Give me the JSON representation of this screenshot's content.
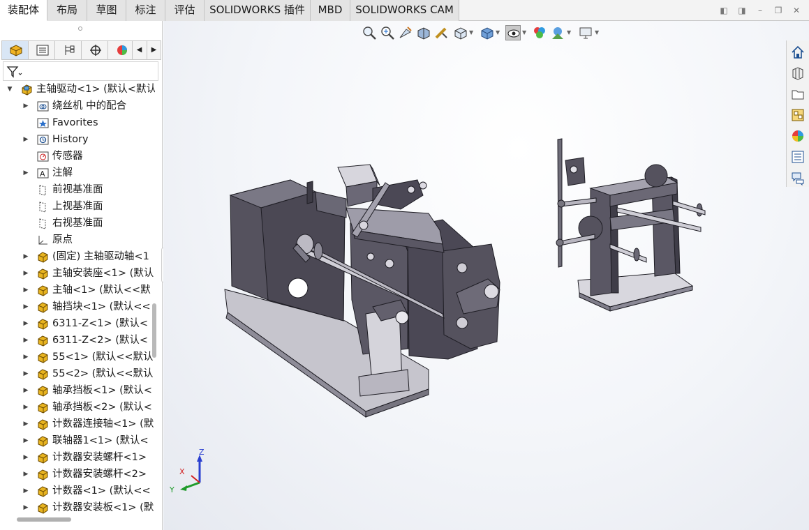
{
  "tabs": [
    "装配体",
    "布局",
    "草图",
    "标注",
    "评估",
    "SOLIDWORKS 插件",
    "MBD",
    "SOLIDWORKS CAM"
  ],
  "active_tab": "装配体",
  "tree": {
    "root": "主轴驱动<1> (默认<默认",
    "items": [
      {
        "label": "绕丝机 中的配合",
        "icon": "mates-folder-icon"
      },
      {
        "label": "Favorites",
        "icon": "favorites-folder-icon"
      },
      {
        "label": "History",
        "icon": "history-folder-icon"
      },
      {
        "label": "传感器",
        "icon": "sensors-icon"
      },
      {
        "label": "注解",
        "icon": "annotations-icon"
      },
      {
        "label": "前视基准面",
        "icon": "plane-icon"
      },
      {
        "label": "上视基准面",
        "icon": "plane-icon"
      },
      {
        "label": "右视基准面",
        "icon": "plane-icon"
      },
      {
        "label": "原点",
        "icon": "origin-icon"
      },
      {
        "label": "(固定) 主轴驱动轴<1",
        "icon": "part-icon"
      },
      {
        "label": "主轴安装座<1> (默认",
        "icon": "part-icon"
      },
      {
        "label": "主轴<1> (默认<<默",
        "icon": "part-icon"
      },
      {
        "label": "轴挡块<1> (默认<<",
        "icon": "part-icon"
      },
      {
        "label": "6311-Z<1> (默认<",
        "icon": "part-icon"
      },
      {
        "label": "6311-Z<2> (默认<",
        "icon": "part-icon"
      },
      {
        "label": "55<1> (默认<<默认",
        "icon": "part-icon"
      },
      {
        "label": "55<2> (默认<<默认",
        "icon": "part-icon"
      },
      {
        "label": "轴承挡板<1> (默认<",
        "icon": "part-icon"
      },
      {
        "label": "轴承挡板<2> (默认<",
        "icon": "part-icon"
      },
      {
        "label": "计数器连接轴<1> (默",
        "icon": "part-icon"
      },
      {
        "label": "联轴器1<1> (默认<",
        "icon": "part-icon"
      },
      {
        "label": "计数器安装螺杆<1> ",
        "icon": "part-icon"
      },
      {
        "label": "计数器安装螺杆<2> ",
        "icon": "part-icon"
      },
      {
        "label": "计数器<1> (默认<<",
        "icon": "part-icon"
      },
      {
        "label": "计数器安装板<1> (默",
        "icon": "part-icon"
      }
    ]
  },
  "triad": {
    "x": "X",
    "y": "Y",
    "z": "Z"
  },
  "colors": {
    "x_axis": "#d22020",
    "y_axis": "#1e9b2a",
    "z_axis": "#2a3fd0",
    "part": "#e8b420",
    "model": "#55525e"
  }
}
